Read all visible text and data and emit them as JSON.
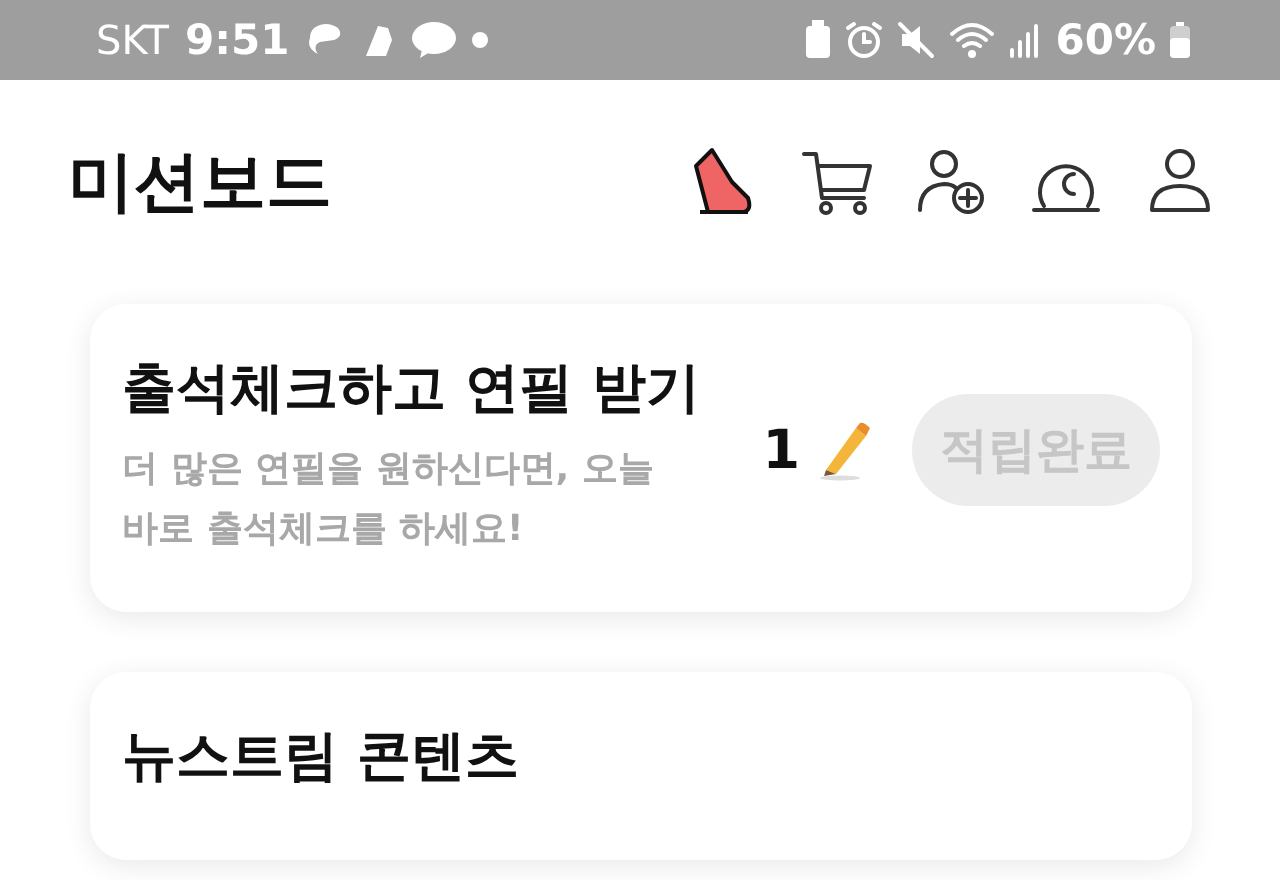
{
  "status_bar": {
    "carrier": "SKT",
    "time": "9:51",
    "battery": "60%"
  },
  "header": {
    "title": "미션보드"
  },
  "missions": [
    {
      "title": "출석체크하고 연필 받기",
      "description": "더 많은 연필을 원하신다면, 오늘 바로 출석체크를 하세요!",
      "reward": "1",
      "button": {
        "label": "적립완료",
        "disabled": true
      }
    },
    {
      "title": "뉴스트림 콘텐츠"
    }
  ]
}
